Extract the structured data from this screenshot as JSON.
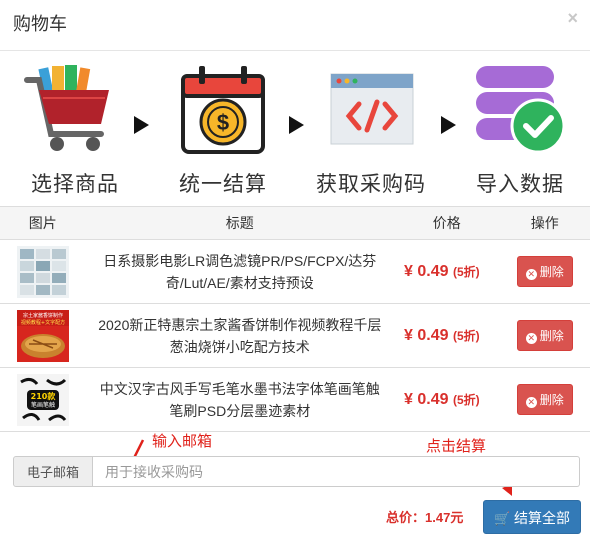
{
  "dialog": {
    "title": "购物车",
    "close": "×"
  },
  "steps": [
    {
      "label": "选择商品",
      "icon": "cart-icon"
    },
    {
      "label": "统一结算",
      "icon": "calendar-dollar-icon"
    },
    {
      "label": "获取采购码",
      "icon": "code-window-icon"
    },
    {
      "label": "导入数据",
      "icon": "database-check-icon"
    }
  ],
  "table": {
    "headers": [
      "图片",
      "标题",
      "价格",
      "操作"
    ],
    "rows": [
      {
        "title": "日系摄影电影LR调色滤镜PR/PS/FCPX/达芬奇/Lut/AE/素材支持预设",
        "price": "¥ 0.49",
        "discount": "(5折)",
        "action": "删除"
      },
      {
        "title": "2020新正特惠宗土家酱香饼制作视频教程千层葱油烧饼小吃配方技术",
        "price": "¥ 0.49",
        "discount": "(5折)",
        "action": "删除",
        "thumb_text": "宗土家酱香饼制作",
        "thumb_text2": "视频教程+文字配方"
      },
      {
        "title": "中文汉字古风手写毛笔水墨书法字体笔画笔触笔刷PSD分层墨迹素材",
        "price": "¥ 0.49",
        "discount": "(5折)",
        "action": "删除",
        "thumb_text": "210款",
        "thumb_text2": "笔画笔触"
      }
    ]
  },
  "email": {
    "label": "电子邮箱",
    "placeholder": "用于接收采购码",
    "value": ""
  },
  "summary": {
    "total_label": "总价：",
    "total_value": "1.47元",
    "checkout_label": "结算全部"
  },
  "annotations": {
    "email_hint": "输入邮箱",
    "checkout_hint": "点击结算"
  },
  "colors": {
    "primary": "#337ab7",
    "danger": "#d9534f",
    "price": "#d9302c",
    "annotation": "#e0221b"
  }
}
